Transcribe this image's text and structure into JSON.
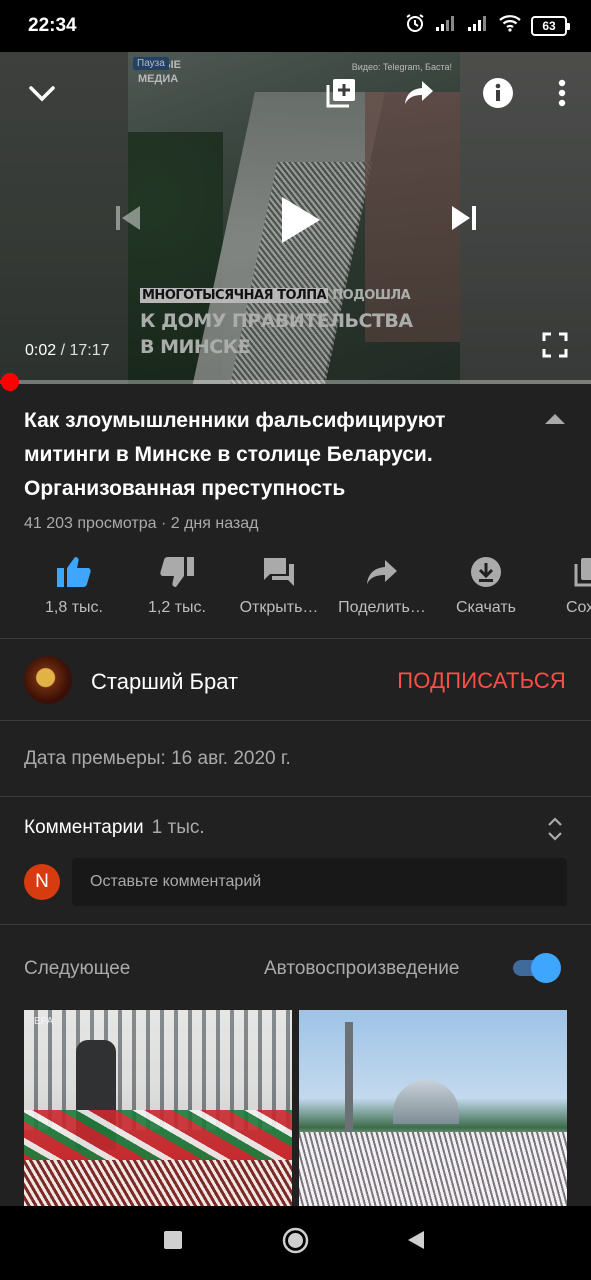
{
  "status_bar": {
    "time": "22:34",
    "battery": "63"
  },
  "video": {
    "current_time": "0:02",
    "separator": "/",
    "duration": "17:17",
    "progress_fraction": 0.002,
    "overlay": {
      "pause_tag": "Пауза",
      "brand_line1": "РЫТЫЕ",
      "brand_line2": "МЕДИА",
      "credit": "Видео: Telegram, Баста!",
      "caption_highlight": "МНОГОТЫСЯЧНАЯ ТОЛПА",
      "caption_rest": "ПОДОШЛА",
      "caption_line2": "К ДОМУ ПРАВИТЕЛЬСТВА",
      "caption_line3": "В МИНСКЕ"
    }
  },
  "info": {
    "title": "Как злоумышленники фальсифицируют митинги в Минске в столице Беларуси. Организованная преступность",
    "views": "41 203 просмотра",
    "age": "2 дня назад",
    "meta_separator": "·"
  },
  "actions": [
    {
      "label": "1,8 тыс.",
      "icon": "thumb-up-icon"
    },
    {
      "label": "1,2 тыс.",
      "icon": "thumb-down-icon"
    },
    {
      "label": "Открыть…",
      "icon": "chat-icon"
    },
    {
      "label": "Поделить…",
      "icon": "share-icon"
    },
    {
      "label": "Скачать",
      "icon": "download-icon"
    },
    {
      "label": "Сохра",
      "icon": "save-icon"
    }
  ],
  "channel": {
    "name": "Старший Брат",
    "subscribe": "ПОДПИСАТЬСЯ"
  },
  "premiere": "Дата премьеры: 16 авг. 2020 г.",
  "comments": {
    "title": "Комментарии",
    "count": "1 тыс.",
    "user_initial": "N",
    "placeholder": "Оставьте комментарий"
  },
  "up_next": {
    "title": "Следующее",
    "autoplay_label": "Автовоспроизведение",
    "autoplay_on": true,
    "thumb1_watermark": "EPA"
  },
  "colors": {
    "accent": "#ff0000",
    "subscribe": "#ff4e45",
    "toggle": "#3ea6ff",
    "like_active": "#3ea6ff"
  }
}
